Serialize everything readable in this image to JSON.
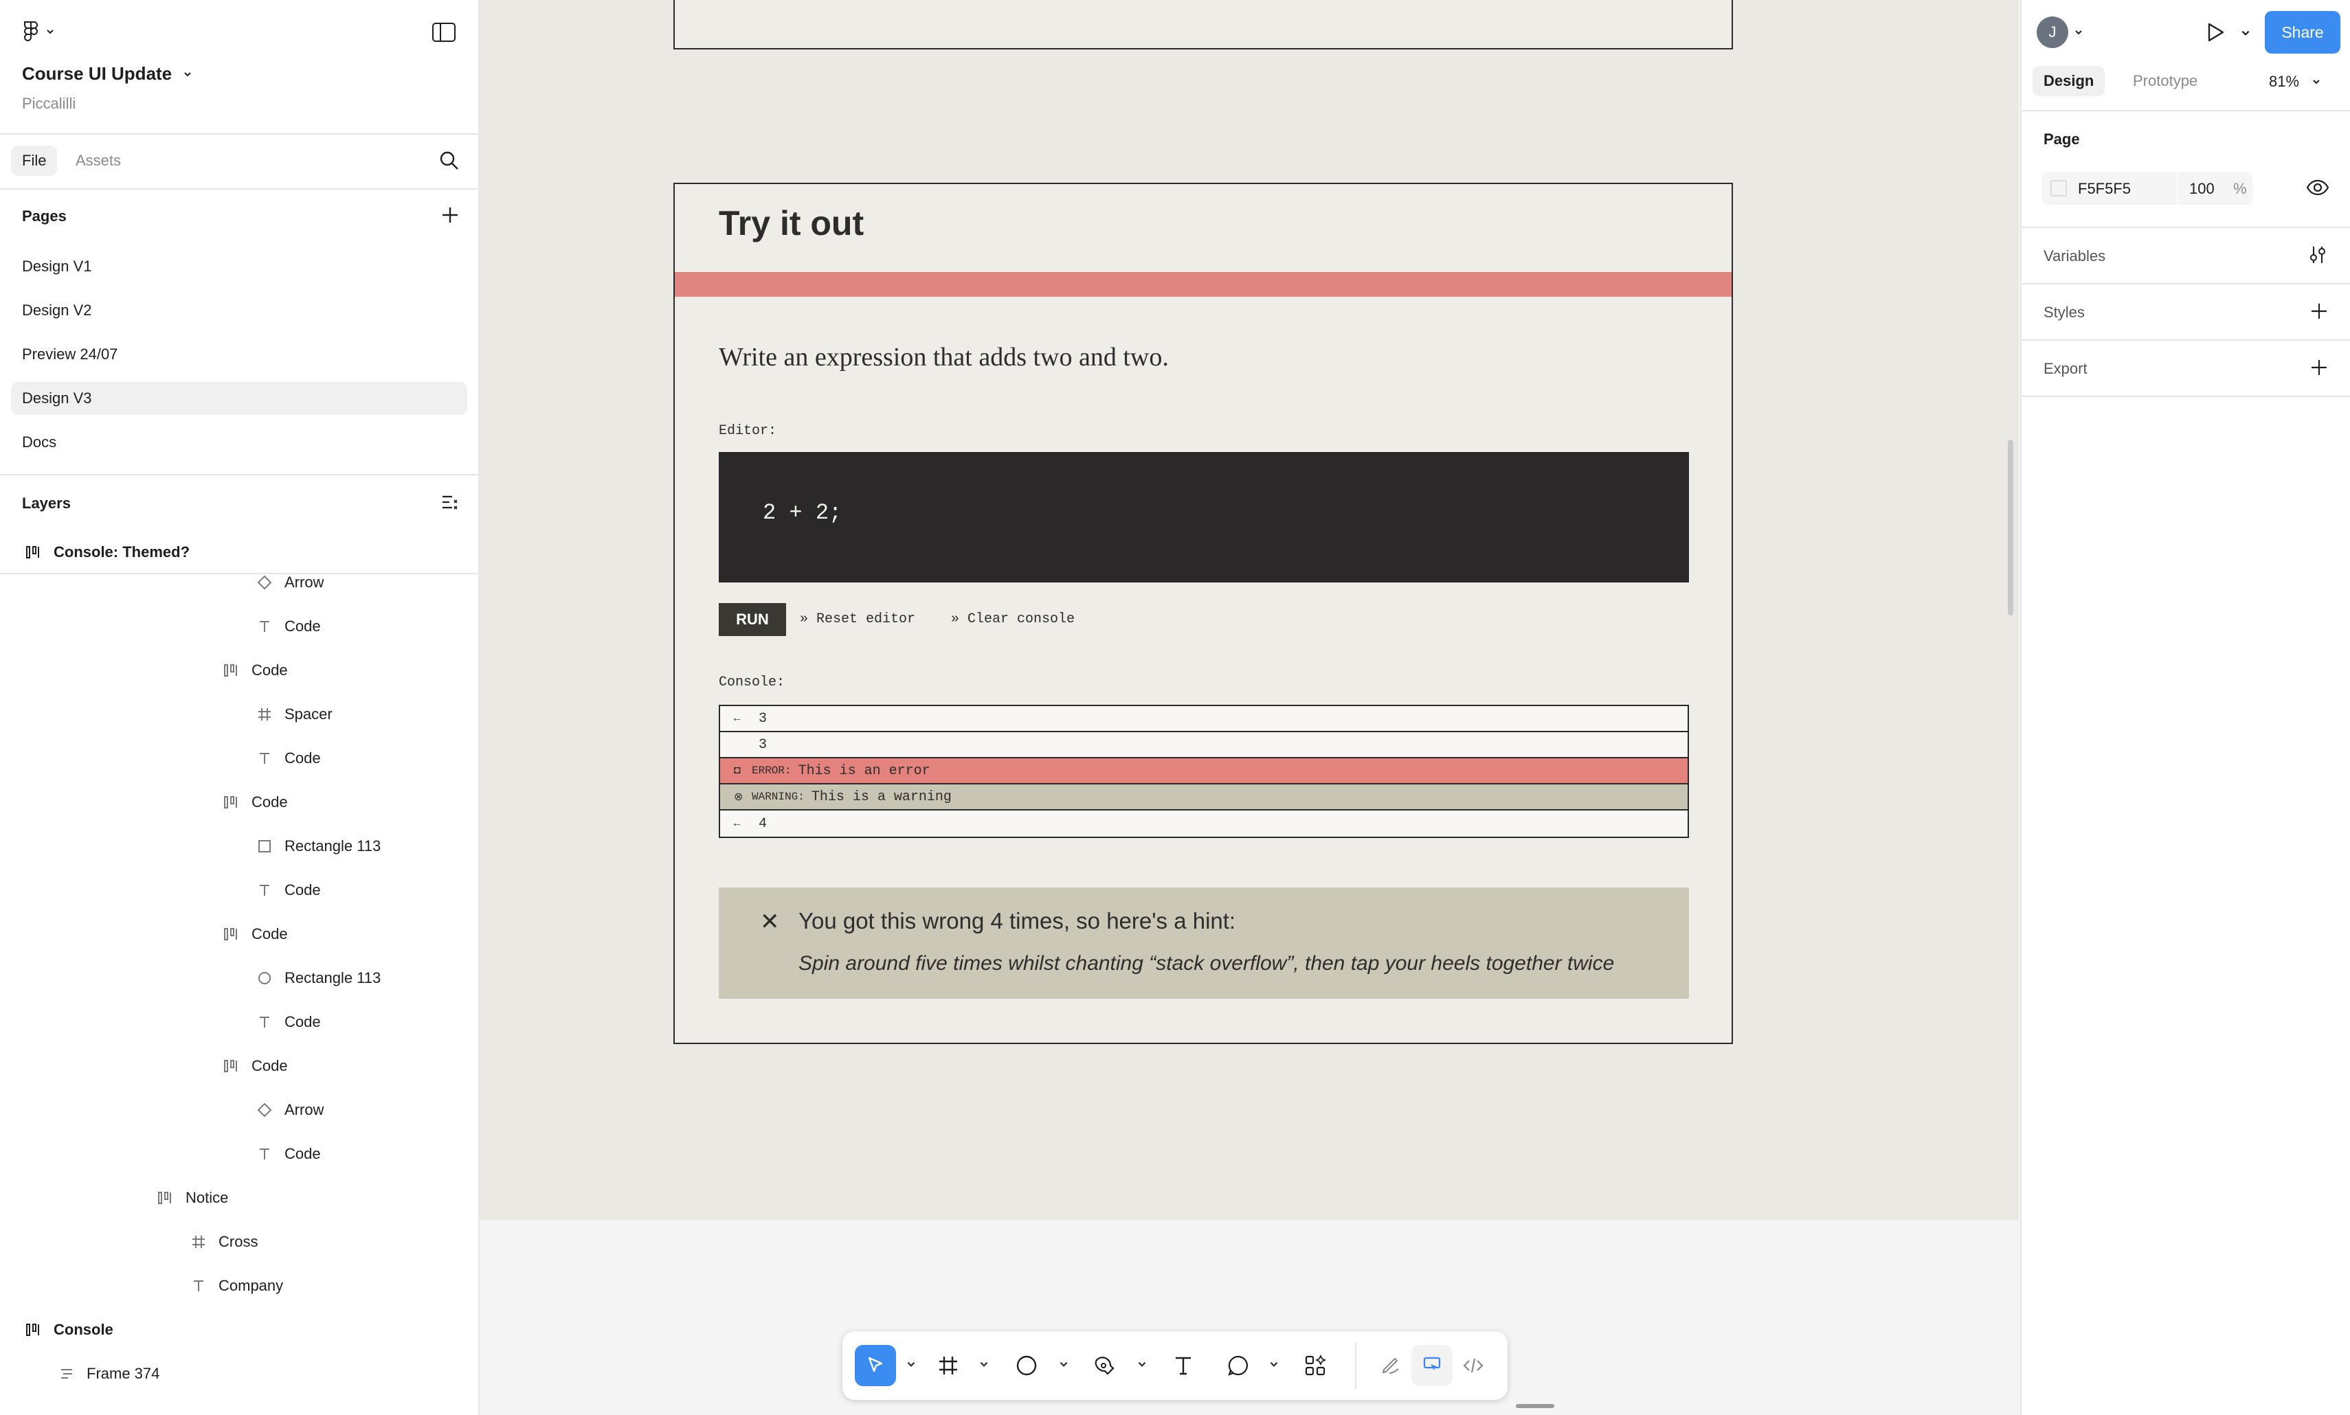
{
  "file": {
    "title": "Course UI Update",
    "team": "Piccalilli"
  },
  "left_tabs": {
    "file": "File",
    "assets": "Assets"
  },
  "pages": {
    "heading": "Pages",
    "items": [
      "Design V1",
      "Design V2",
      "Preview 24/07",
      "Design V3",
      "Docs"
    ],
    "selected": "Design V3"
  },
  "layers": {
    "heading": "Layers",
    "pinned": "Console: Themed?",
    "items": [
      {
        "label": "Arrow",
        "icon": "component-instance-icon"
      },
      {
        "label": "Code",
        "icon": "text-icon"
      },
      {
        "label": "Code",
        "icon": "auto-layout-icon"
      },
      {
        "label": "Spacer",
        "icon": "frame-icon"
      },
      {
        "label": "Code",
        "icon": "text-icon"
      },
      {
        "label": "Code",
        "icon": "auto-layout-icon"
      },
      {
        "label": "Rectangle 113",
        "icon": "rectangle-icon"
      },
      {
        "label": "Code",
        "icon": "text-icon"
      },
      {
        "label": "Code",
        "icon": "auto-layout-icon"
      },
      {
        "label": "Rectangle 113",
        "icon": "ellipse-icon"
      },
      {
        "label": "Code",
        "icon": "text-icon"
      },
      {
        "label": "Code",
        "icon": "auto-layout-icon"
      },
      {
        "label": "Arrow",
        "icon": "component-instance-icon"
      },
      {
        "label": "Code",
        "icon": "text-icon"
      },
      {
        "label": "Notice",
        "icon": "auto-layout-icon"
      },
      {
        "label": "Cross",
        "icon": "frame-icon"
      },
      {
        "label": "Company",
        "icon": "text-icon"
      },
      {
        "label": "Console",
        "icon": "auto-layout-icon"
      },
      {
        "label": "Frame 374",
        "icon": "auto-layout-rows-icon"
      }
    ]
  },
  "canvas": {
    "card_title": "Try it out",
    "prompt": "Write an expression that adds two and two.",
    "editor_label": "Editor:",
    "editor_code": "2 + 2;",
    "run_label": "RUN",
    "reset_label": "» Reset editor",
    "clear_label": "» Clear console",
    "console_label": "Console:",
    "console_rows": [
      {
        "prefix": "←",
        "tag": "",
        "text": "3",
        "type": "return"
      },
      {
        "prefix": "",
        "tag": "",
        "text": "3",
        "type": "log"
      },
      {
        "prefix": "◘",
        "tag": "ERROR:",
        "text": "This is an error",
        "type": "error"
      },
      {
        "prefix": "⊗",
        "tag": "WARNING:",
        "text": "This is a warning",
        "type": "warning"
      },
      {
        "prefix": "←",
        "tag": "",
        "text": "4",
        "type": "return"
      }
    ],
    "hint_title": "You got this wrong 4 times, so here's a hint:",
    "hint_body": "Spin around five times whilst chanting “stack overflow”, then tap your heels together twice",
    "hint_close": "✕"
  },
  "right": {
    "avatar": "J",
    "share": "Share",
    "tab_design": "Design",
    "tab_prototype": "Prototype",
    "zoom": "81%",
    "page_section": "Page",
    "page_color": "F5F5F5",
    "page_opacity": "100",
    "percent": "%",
    "variables": "Variables",
    "styles": "Styles",
    "export": "Export"
  },
  "colors": {
    "accent": "#3b82f6",
    "error_row": "#e4837d",
    "warning_row": "#c9c5b4",
    "band": "#e08580",
    "editor_bg": "#2a2828",
    "hint_bg": "#cbc8b8"
  }
}
